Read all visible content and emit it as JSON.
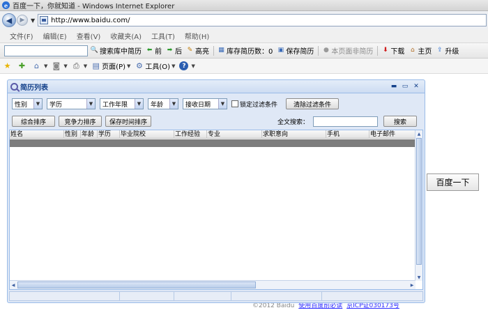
{
  "window": {
    "title": "百度一下，你就知道 - Windows Internet Explorer"
  },
  "address": {
    "url": "http://www.baidu.com/"
  },
  "menu": [
    "文件(F)",
    "编辑(E)",
    "查看(V)",
    "收藏夹(A)",
    "工具(T)",
    "帮助(H)"
  ],
  "toolbar": {
    "search_resume": "搜索库中简历",
    "prev": "前",
    "next": "后",
    "highlight": "高亮",
    "stored_count": "库存简历数：0",
    "save_resume": "保存简历",
    "not_resume": "本页面非简历",
    "download": "下载",
    "home": "主页",
    "upgrade": "升级"
  },
  "commandbar": {
    "page": "页面(P)",
    "tools": "工具(O)"
  },
  "background_page": {
    "search_button": "百度一下",
    "footer_copy": "©2012 Baidu",
    "footer_link1": "使用百度前必读",
    "footer_link2": "京ICP证030173号"
  },
  "panel": {
    "title": "简历列表",
    "filters": {
      "gender": "性别",
      "education": "学历",
      "work_years": "工作年限",
      "age": "年龄",
      "receive_date": "接收日期",
      "lock_label": "锁定过滤条件",
      "clear_button": "清除过滤条件"
    },
    "sort": {
      "overall": "综合排序",
      "competitiveness": "竞争力排序",
      "save_time": "保存时间排序"
    },
    "fulltext_label": "全文搜索：",
    "fulltext_value": "",
    "search_button": "搜索",
    "columns": [
      "姓名",
      "性别",
      "年龄",
      "学历",
      "毕业院校",
      "工作经验",
      "专业",
      "求职意向",
      "手机",
      "电子邮件"
    ]
  }
}
